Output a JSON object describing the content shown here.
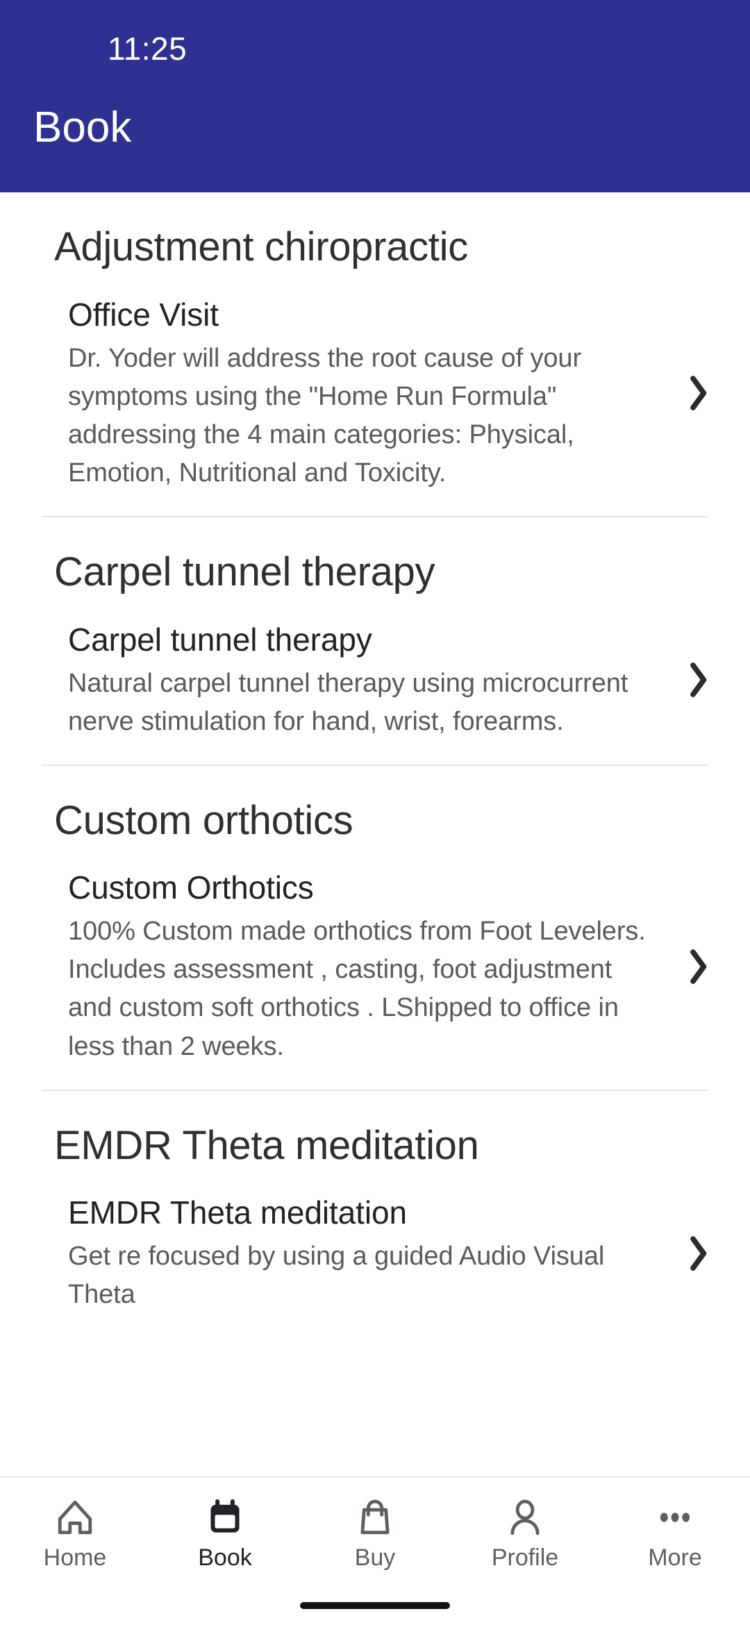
{
  "theme": {
    "header_bg": "#2e3192",
    "header_text": "#ffffff",
    "section_title_color": "#2f2f2f",
    "item_title_color": "#222222",
    "item_desc_color": "#5a5a5a",
    "divider_color": "#e4e4e6",
    "tab_inactive_color": "#5c5f66",
    "tab_active_color": "#212328"
  },
  "status_bar": {
    "time": "11:25"
  },
  "header": {
    "title": "Book"
  },
  "sections": [
    {
      "heading": "Adjustment chiropractic",
      "items": [
        {
          "title": "Office Visit",
          "description": "Dr. Yoder will address the root cause of your symptoms using the \"Home Run Formula\" addressing the 4 main categories: Physical, Emotion, Nutritional and Toxicity.",
          "chevron_icon": "chevron-right-icon"
        }
      ],
      "divider": true
    },
    {
      "heading": "Carpel tunnel therapy",
      "items": [
        {
          "title": "Carpel tunnel therapy",
          "description": "Natural carpel tunnel therapy using microcurrent nerve stimulation for hand, wrist, forearms.",
          "chevron_icon": "chevron-right-icon"
        }
      ],
      "divider": true
    },
    {
      "heading": "Custom orthotics",
      "items": [
        {
          "title": "Custom Orthotics",
          "description": "100% Custom made orthotics from Foot Levelers. Includes assessment , casting, foot adjustment and custom soft orthotics . LShipped to office in less than 2 weeks.",
          "chevron_icon": "chevron-right-icon"
        }
      ],
      "divider": true
    },
    {
      "heading": "EMDR Theta meditation",
      "items": [
        {
          "title": "EMDR Theta meditation",
          "description": "Get re focused by using a guided Audio Visual Theta",
          "chevron_icon": "chevron-right-icon"
        }
      ],
      "divider": false
    }
  ],
  "tabbar": {
    "active_index": 1,
    "tabs": [
      {
        "label": "Home",
        "icon": "home-icon"
      },
      {
        "label": "Book",
        "icon": "calendar-icon"
      },
      {
        "label": "Buy",
        "icon": "shopping-bag-icon"
      },
      {
        "label": "Profile",
        "icon": "person-icon"
      },
      {
        "label": "More",
        "icon": "more-horizontal-icon"
      }
    ]
  }
}
